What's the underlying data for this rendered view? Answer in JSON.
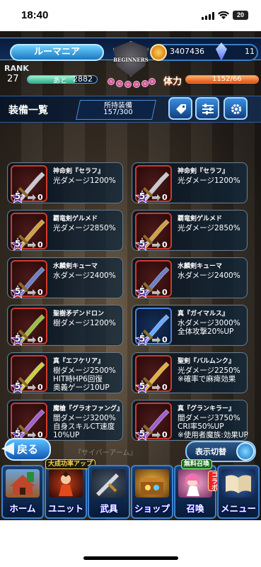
{
  "status_bar": {
    "time": "18:40",
    "battery": "20"
  },
  "header": {
    "player_name": "ルーマニア",
    "coins": "3407436",
    "gems": "11",
    "logo_text": "BEGINNERS",
    "rank_label": "RANK",
    "rank_value": "27",
    "exp_next_label": "あと",
    "exp_next_value": "2882",
    "hp_label": "体力",
    "hp_value": "1152/66"
  },
  "list": {
    "title": "装備一覧",
    "owned_label": "所持装備",
    "owned_count": "157/300"
  },
  "equipment": [
    {
      "name": "神命剣『セラフ』",
      "effect": "光ダメージ1200%",
      "stars": "5",
      "count": "0",
      "frame": "red"
    },
    {
      "name": "神命剣『セラフ』",
      "effect": "光ダメージ1200%",
      "stars": "5",
      "count": "0",
      "frame": "red"
    },
    {
      "name": "覇竜剣ゲルメド",
      "effect": "光ダメージ2850%",
      "stars": "5",
      "count": "0",
      "frame": "red"
    },
    {
      "name": "覇竜剣ゲルメド",
      "effect": "光ダメージ2850%",
      "stars": "5",
      "count": "0",
      "frame": "red"
    },
    {
      "name": "水麟剣キューマ",
      "effect": "水ダメージ2400%",
      "stars": "5",
      "count": "0",
      "frame": "red"
    },
    {
      "name": "水麟剣キューマ",
      "effect": "水ダメージ2400%",
      "stars": "5",
      "count": "0",
      "frame": "red"
    },
    {
      "name": "聖樹矛デンドロン",
      "effect": "樹ダメージ1200%",
      "stars": "5",
      "count": "0",
      "frame": "red"
    },
    {
      "name": "真『ガイマルス』",
      "effect": "水ダメージ3000%\n全体攻撃20%UP",
      "stars": "5",
      "count": "0",
      "frame": "blue"
    },
    {
      "name": "真『エフケリア』",
      "effect": "樹ダメージ2500%\nHIT時HP6回復\n奥義ゲージ10UP",
      "stars": "5",
      "count": "0",
      "frame": "red"
    },
    {
      "name": "聖剣『バルムンク』",
      "effect": "光ダメージ2250%\n※確率で麻痺効果",
      "stars": "5",
      "count": "0",
      "frame": "red"
    },
    {
      "name": "魔槍『グラオファング』",
      "effect": "闇ダメージ3200%\n自身スキルCT速度\n10%UP",
      "stars": "5",
      "count": "0",
      "frame": "red"
    },
    {
      "name": "真『グランキラー』",
      "effect": "闇ダメージ3750%\nCRI率50%UP\n※使用者魔族:効果UP",
      "stars": "5",
      "count": "0",
      "frame": "red"
    }
  ],
  "controls": {
    "back_label": "戻る",
    "toggle_label": "表示切替",
    "partial_row_text": "『サイバーアーム』"
  },
  "menu": [
    {
      "label": "ホーム",
      "icon": "home-icon"
    },
    {
      "label": "ユニット",
      "icon": "unit-icon",
      "badge": "大成功率アップ"
    },
    {
      "label": "武具",
      "icon": "weapon-icon"
    },
    {
      "label": "ショップ",
      "icon": "shop-icon"
    },
    {
      "label": "召喚",
      "icon": "summon-icon",
      "badge": "無料召喚",
      "badge2": "コラボ"
    },
    {
      "label": "メニュー",
      "icon": "menu-book-icon"
    }
  ]
}
